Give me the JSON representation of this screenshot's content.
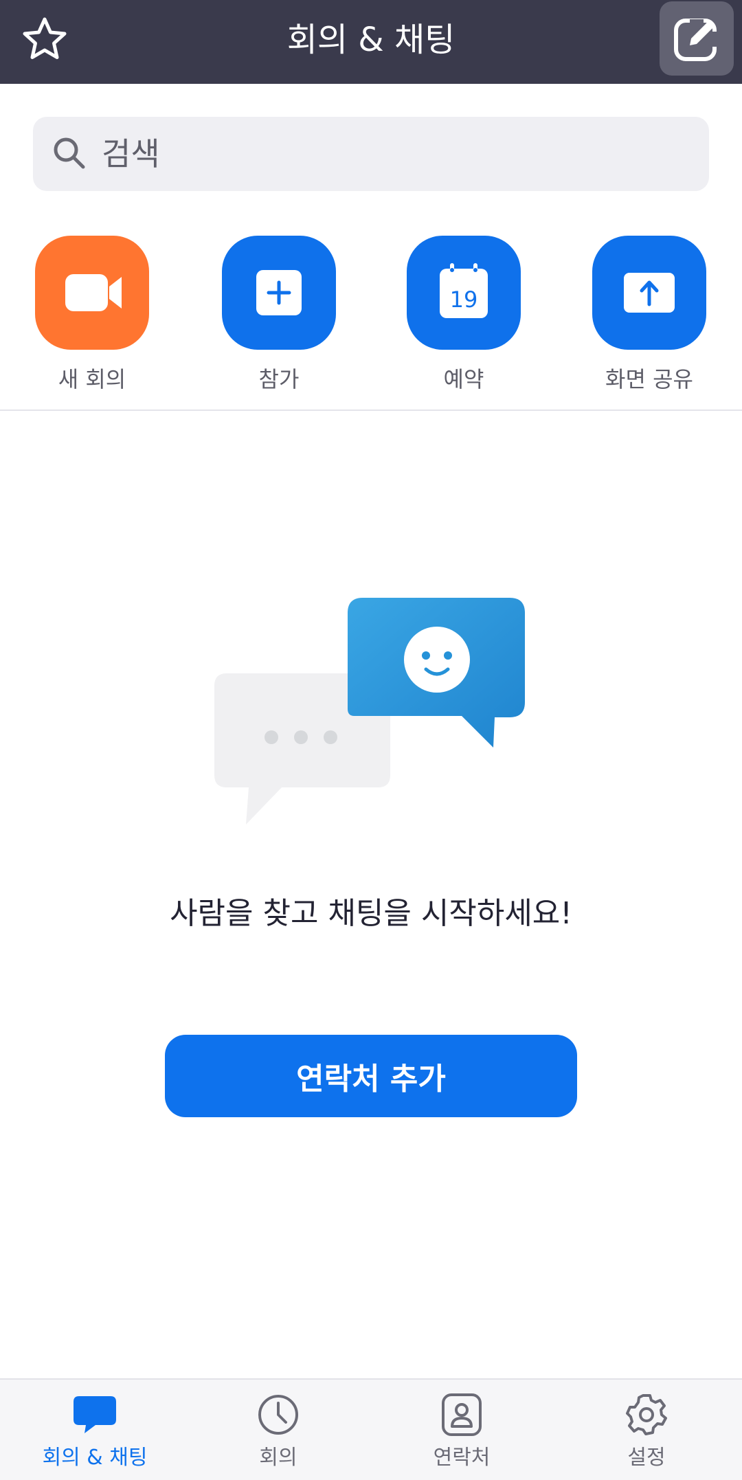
{
  "header": {
    "title": "회의 & 채팅",
    "star_icon": "star-outline-icon",
    "compose_icon": "compose-edit-icon"
  },
  "search": {
    "placeholder": "검색",
    "icon": "search-icon"
  },
  "actions": [
    {
      "label": "새 회의",
      "icon": "video-camera-icon",
      "color": "#ff7530"
    },
    {
      "label": "참가",
      "icon": "plus-square-icon",
      "color": "#0f71eb"
    },
    {
      "label": "예약",
      "icon": "calendar-icon",
      "color": "#0f71eb",
      "calendar_day": "19"
    },
    {
      "label": "화면 공유",
      "icon": "share-up-arrow-icon",
      "color": "#0f71eb"
    }
  ],
  "empty_state": {
    "illustration": "chat-bubbles-illustration",
    "message": "사람을 찾고 채팅을 시작하세요!",
    "button_label": "연락처 추가"
  },
  "bottom_nav": [
    {
      "label": "회의 & 채팅",
      "icon": "chat-bubble-icon",
      "active": true
    },
    {
      "label": "회의",
      "icon": "clock-icon",
      "active": false
    },
    {
      "label": "연락처",
      "icon": "contact-card-icon",
      "active": false
    },
    {
      "label": "설정",
      "icon": "gear-icon",
      "active": false
    }
  ],
  "colors": {
    "header_bg": "#3a3a4c",
    "accent_blue": "#0e72ed",
    "accent_orange": "#ff7530"
  }
}
